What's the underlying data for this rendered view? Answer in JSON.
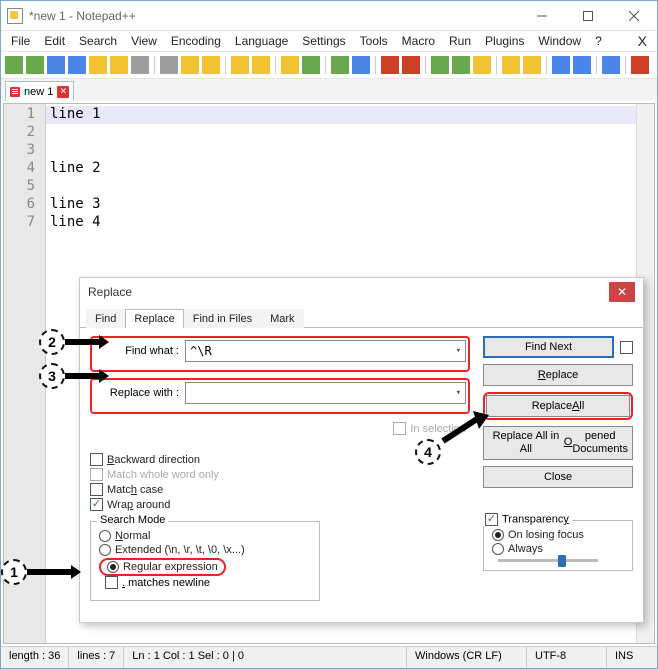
{
  "window": {
    "title": "*new 1 - Notepad++"
  },
  "menu": {
    "items": [
      "File",
      "Edit",
      "Search",
      "View",
      "Encoding",
      "Language",
      "Settings",
      "Tools",
      "Macro",
      "Run",
      "Plugins",
      "Window",
      "?"
    ]
  },
  "filetab": {
    "name": "new 1"
  },
  "lines": {
    "l1": "line 1",
    "l2": "",
    "l3": "",
    "l4": "line 2",
    "l5": "",
    "l6": "line 3",
    "l7": "line 4"
  },
  "gutter": {
    "n1": "1",
    "n2": "2",
    "n3": "3",
    "n4": "4",
    "n5": "5",
    "n6": "6",
    "n7": "7"
  },
  "status": {
    "length": "length : 36",
    "lines": "lines : 7",
    "pos": "Ln : 1    Col : 1    Sel : 0 | 0",
    "eol": "Windows (CR LF)",
    "enc": "UTF-8",
    "ins": "INS"
  },
  "dialog": {
    "title": "Replace",
    "tabs": {
      "find": "Find",
      "replace": "Replace",
      "findinfiles": "Find in Files",
      "mark": "Mark"
    },
    "find_label": "Find what :",
    "find_value": "^\\R",
    "replace_label": "Replace with :",
    "replace_value": "",
    "in_selection": "In selection",
    "backward": "Backward direction",
    "whole": "Match whole word only",
    "case": "Match case",
    "wrap": "Wrap around",
    "mode_legend": "Search Mode",
    "mode_normal": "Normal",
    "mode_ext": "Extended (\\n, \\r, \\t, \\0, \\x...)",
    "mode_regex": "Regular expression",
    "matches_newline": ". matches newline",
    "trans_legend": "Transparency",
    "trans_losing": "On losing focus",
    "trans_always": "Always",
    "buttons": {
      "findnext": "Find Next",
      "replace": "Replace",
      "replaceall": "Replace All",
      "replaceallopen": "Replace All in All Opened Documents",
      "close": "Close"
    }
  },
  "annotations": {
    "a1": "1",
    "a2": "2",
    "a3": "3",
    "a4": "4"
  },
  "toolbar_colors": {
    "c1": "#6aa84f",
    "c2": "#6aa84f",
    "c3": "#4a86e8",
    "c4": "#4a86e8",
    "c5": "#f1c232",
    "c6": "#f1c232",
    "c7": "#9e9e9e",
    "c8": "#9e9e9e",
    "c9": "#f1c232",
    "c10": "#f1c232",
    "c11": "#f1c232",
    "c12": "#f1c232",
    "c13": "#f1c232",
    "c14": "#6aa84f",
    "c15": "#6aa84f",
    "c16": "#4a86e8",
    "c17": "#cc4125",
    "c18": "#cc4125",
    "c19": "#6aa84f",
    "c20": "#6aa84f",
    "c21": "#f1c232",
    "c22": "#f1c232",
    "c23": "#f1c232",
    "c24": "#4a86e8",
    "c25": "#4a86e8",
    "c26": "#4a86e8",
    "c27": "#cc4125",
    "c28": "#cc4125",
    "c29": "#6aa84f",
    "c30": "#cc4125"
  }
}
